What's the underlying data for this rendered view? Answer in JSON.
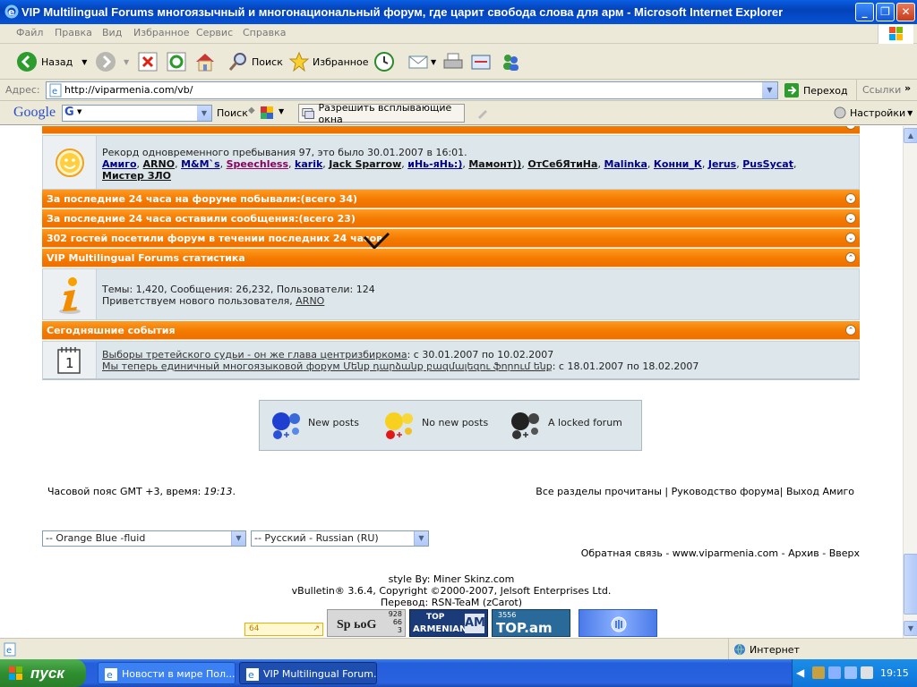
{
  "window": {
    "title": "VIP Multilingual Forums многоязычный и многонациональный форум, где царит свобода слова для арм - Microsoft Internet Explorer"
  },
  "menu": [
    "Файл",
    "Правка",
    "Вид",
    "Избранное",
    "Сервис",
    "Справка"
  ],
  "toolbar": {
    "back_label": "Назад",
    "search_label": "Поиск",
    "favorites_label": "Избранное"
  },
  "address": {
    "label": "Адрес:",
    "url": "http://viparmenia.com/vb/",
    "go_label": "Переход",
    "links_label": "Ссылки"
  },
  "googlebar": {
    "logo": "Google",
    "search_label": "Поиск",
    "popup_label": "Разрешить всплывающие окна",
    "settings_label": "Настройки"
  },
  "forum": {
    "record_text": "Рекорд одновременного пребывания 97, это было 30.01.2007 в 16:01.",
    "users_line1": [
      "Амиго",
      "ARNO",
      "M&M`s",
      "Speechless",
      "karik",
      "Jack Sparrow",
      "иНь-яНь:)",
      "Мамонт))",
      "ОтСебЯтиНа",
      "Malinka",
      "Конни_К",
      "Jerus",
      "PusSycat"
    ],
    "users_line2": [
      "Мистер ЗЛО"
    ],
    "bar_visited": "За последние 24 часа на форуме побывали:(всего 34)",
    "bar_posted": "За последние 24 часа оставили сообщения:(всего 23)",
    "bar_guests": "302 гостей посетили форум в течении последних 24 часов",
    "bar_stats": "VIP Multilingual Forums статистика",
    "stats_text": "Темы: 1,420, Сообщения: 26,232, Пользователи: 124",
    "welcome_text": "Приветствуем нового пользователя,",
    "welcome_user": "ARNO",
    "bar_events": "Сегодняшние события",
    "event1_link": "Выборы третейского судьи - он же глава центризбиркома",
    "event1_dates": ": с 30.01.2007 по 10.02.2007",
    "event2_link": "Мы теперь единичный многоязыковой форум Մենք դարձանք բազմալեզու ֆորում ենք",
    "event2_dates": ": с 18.01.2007 по 18.02.2007",
    "calendar_number": "1"
  },
  "legend": {
    "new_posts": "New posts",
    "no_new_posts": "No new posts",
    "locked": "A locked forum"
  },
  "footer": {
    "timezone_prefix": "Часовой пояс GMT +3, время: ",
    "time": "19:13",
    "timezone_suffix": ".",
    "links_right": "Все разделы прочитаны | Руководство форума| Выход Амиго",
    "style_select": "-- Orange Blue -fluid",
    "lang_select": "-- Русский - Russian (RU)",
    "bottom_links": "Обратная связь - www.viparmenia.com - Архив - Вверх",
    "style_by": "style By: Miner Skinz.com",
    "vbulletin": "vBulletin® 3.6.4, Copyright ©2000-2007, Jelsoft Enterprises Ltd.",
    "translation": "Перевод: RSN-TeaM (zCarot)",
    "counter_small": "64",
    "spylog_label": "Sp ьоG",
    "spylog_nums": [
      "928",
      "66",
      "3"
    ],
    "top_armenian_1": "TOP",
    "top_armenian_2": "ARMENIAN",
    "top_armenian_3": "AM",
    "top_am_count": "3556",
    "top_am_label": "TOP.am"
  },
  "statusbar": {
    "zone": "Интернет"
  },
  "taskbar": {
    "start": "пуск",
    "task1": "Новости в мире Пол...",
    "task2": "VIP Multilingual Forum...",
    "clock": "19:15"
  },
  "colors": {
    "orange_bar": "#f47a00",
    "row_bg": "#dde6eb",
    "link_blue": "#00008b",
    "xp_blue": "#0653d6"
  }
}
